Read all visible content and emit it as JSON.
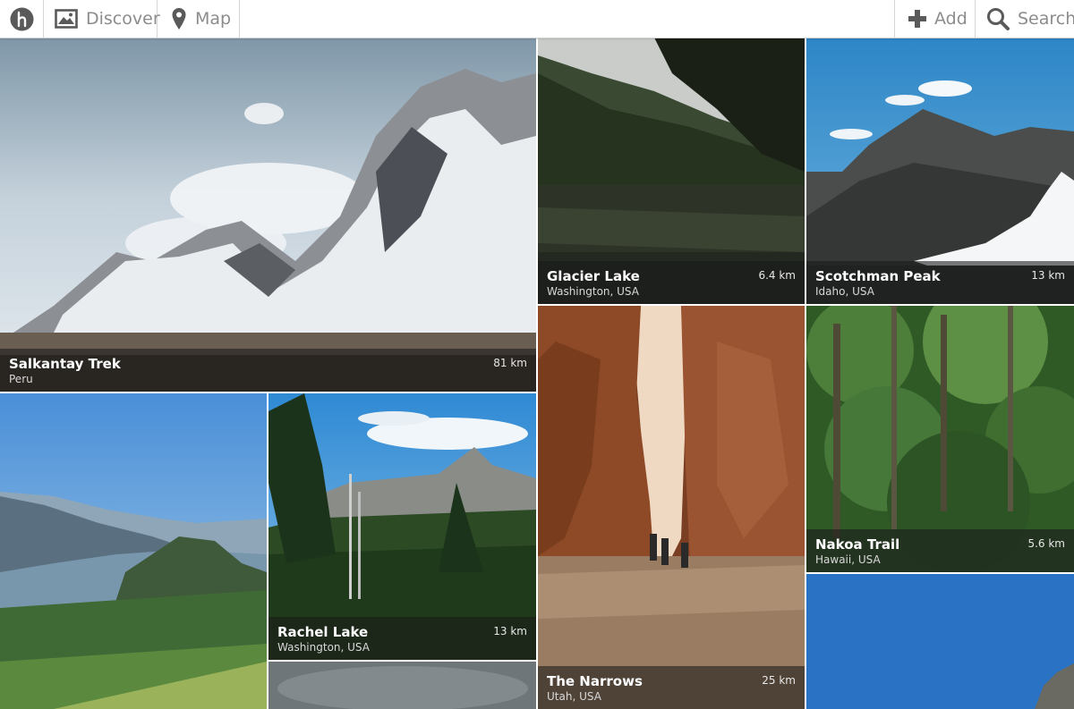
{
  "nav": {
    "logo_icon": "h-logo-icon",
    "discover": {
      "label": "Discover",
      "icon": "image-icon"
    },
    "map": {
      "label": "Map",
      "icon": "map-pin-icon"
    },
    "add": {
      "label": "Add",
      "icon": "plus-icon"
    },
    "search": {
      "label": "Search",
      "icon": "search-icon"
    }
  },
  "hikes": [
    {
      "name": "Salkantay Trek",
      "region": "Peru",
      "distance": "81 km"
    },
    {
      "name": "Glacier Lake",
      "region": "Washington, USA",
      "distance": "6.4 km"
    },
    {
      "name": "Scotchman Peak",
      "region": "Idaho, USA",
      "distance": "13 km"
    },
    {
      "name": "The Narrows",
      "region": "Utah, USA",
      "distance": "25 km"
    },
    {
      "name": "Nakoa Trail",
      "region": "Hawaii, USA",
      "distance": "5.6 km"
    },
    {
      "name": "Rachel Lake",
      "region": "Washington, USA",
      "distance": "13 km"
    }
  ],
  "colors": {
    "nav_text": "#8c8c8c",
    "caption_bg": "rgba(25,25,25,0.58)"
  }
}
